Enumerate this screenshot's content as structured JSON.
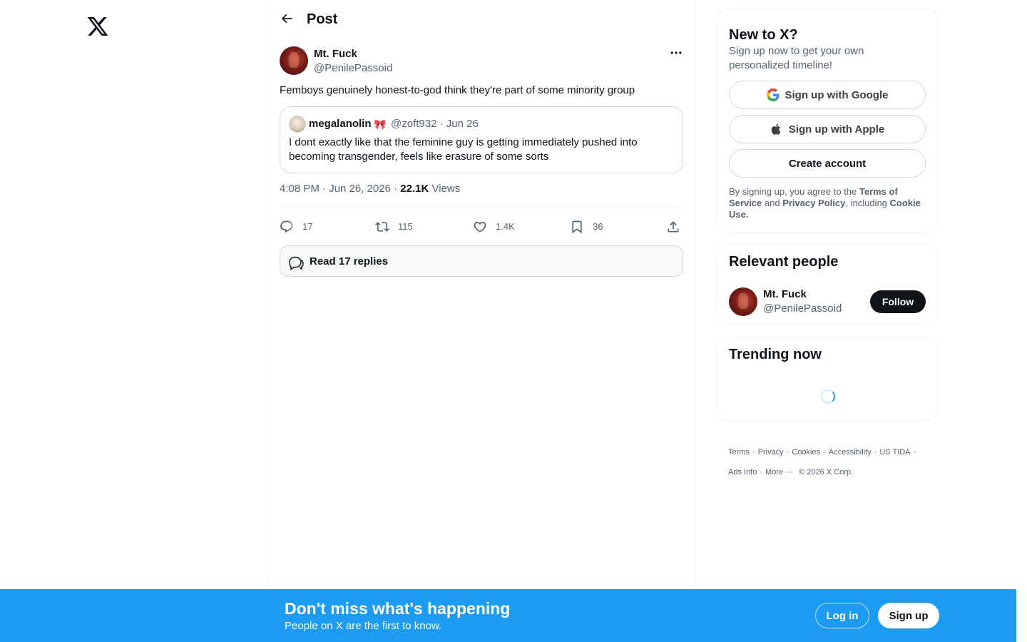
{
  "nav": {
    "logo_icon": "x-logo-icon"
  },
  "header": {
    "back_icon": "arrow-left-icon",
    "title": "Post"
  },
  "tweet": {
    "author_name": "Mt. Fuck",
    "author_handle": "@PenilePassoid",
    "text": "Femboys genuinely honest-to-god think they're part of some minority group",
    "quote": {
      "name": "megalanolin",
      "emoji": "🎀",
      "meta": "@zoft932 · Jun 26",
      "text": "I dont exactly like that the feminine guy is getting immediately pushed into becoming transgender, feels like erasure of some sorts"
    },
    "time": "4:08 PM · Jun 26, 2026 · ",
    "views_count": "22.1K",
    "views_label": "Views",
    "actions": {
      "replies": "17",
      "reposts": "115",
      "likes": "1.4K",
      "bookmarks": "36"
    },
    "read_replies": "Read 17 replies"
  },
  "sidebar": {
    "new_to_x": {
      "title": "New to X?",
      "subtitle": "Sign up now to get your own personalized timeline!",
      "google_label": "Sign up with Google",
      "apple_label": "Sign up with Apple",
      "create_label": "Create account",
      "terms_prefix": "By signing up, you agree to the ",
      "terms_link": "Terms of Service",
      "terms_and": " and ",
      "privacy_link": "Privacy Policy",
      "terms_including": ", including ",
      "cookie_link": "Cookie Use."
    },
    "relevant_people": {
      "title": "Relevant people",
      "name": "Mt. Fuck",
      "handle": "@PenilePassoid",
      "follow_label": "Follow"
    },
    "trending": {
      "title": "Trending now"
    },
    "footer": {
      "terms": "Terms",
      "privacy": "Privacy",
      "cookies": "Cookies",
      "accessibility": "Accessibility",
      "us_tida": "US TIDA",
      "ads_info": "Ads Info",
      "more": "More ···",
      "copyright": "© 2026 X Corp."
    }
  },
  "bottom_bar": {
    "title": "Don't miss what's happening",
    "subtitle": "People on X are the first to know.",
    "login_label": "Log in",
    "signup_label": "Sign up"
  },
  "colors": {
    "accent": "#1d9bf0",
    "text": "#0f1419",
    "muted": "#536471",
    "border": "#cfd9de"
  }
}
